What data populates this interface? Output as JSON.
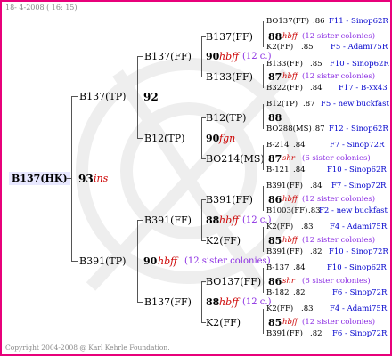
{
  "header": {
    "date": "18- 4-2008 ( 16: 15)"
  },
  "footer": {
    "copyright": "Copyright 2004-2008 @ Karl Kehrle Foundation."
  },
  "colors": {
    "frame": "#e8007a",
    "root_bg": "#e8e8ff",
    "ins": "#cc0000",
    "sister": "#8a2be2",
    "leaf_note": "#0000cc"
  },
  "root": {
    "name": "B137(HK)",
    "number": "93",
    "code": "ins"
  },
  "gen1": [
    {
      "name": "B137(TP)",
      "number": "92"
    },
    {
      "name": "B391(TP)",
      "number": "90",
      "code": "hbff",
      "note": "(12 sister colonies)"
    }
  ],
  "gen2": [
    {
      "name": "B137(FF)",
      "number": "90",
      "code": "hbff",
      "note": "(12 c.)"
    },
    {
      "name": "B12(TP)",
      "number": "90",
      "code": "fgn"
    },
    {
      "name": "B391(FF)",
      "number": "88",
      "code": "hbff",
      "note": "(12 c.)"
    },
    {
      "name": "B137(FF)",
      "number": "88",
      "code": "hbff",
      "note": "(12 c.)"
    }
  ],
  "gen3": [
    {
      "name": "B137(FF)",
      "number": "88",
      "code": "hbff",
      "note": "(12 sister colonies)"
    },
    {
      "name": "B133(FF)",
      "number": "87",
      "code": "hbff",
      "note": "(12 sister colonies)"
    },
    {
      "name": "B12(TP)",
      "number": "88"
    },
    {
      "name": "BO214(MS)",
      "number": "87",
      "code": "shr",
      "note": "(6 sister colonies)"
    },
    {
      "name": "B391(FF)",
      "number": "86",
      "code": "hbff",
      "note": "(12 sister colonies)"
    },
    {
      "name": "K2(FF)",
      "number": "85",
      "code": "hbff",
      "note": "(12 sister colonies)"
    },
    {
      "name": "BO137(FF)",
      "number": "86",
      "code": "shr",
      "note": "(6 sister colonies)"
    },
    {
      "name": "K2(FF)",
      "number": "85",
      "code": "hbff",
      "note": "(12 sister colonies)"
    }
  ],
  "gen4": [
    {
      "name": "BO137(FF)",
      "value": ".86",
      "note": "F11 - Sinop62R"
    },
    {
      "name": "K2(FF)",
      "value": ".85",
      "note": "F5 - Adami75R"
    },
    {
      "name": "B133(FF)",
      "value": ".85",
      "note": "F10 - Sinop62R"
    },
    {
      "name": "B322(FF)",
      "value": ".84",
      "note": "F17 - B-xx43"
    },
    {
      "name": "B12(TP)",
      "value": ".87",
      "note": "F5 - new buckfast"
    },
    {
      "name": "BO288(MS)",
      "value": ".87",
      "note": "F12 - Sinop62R"
    },
    {
      "name": "B-214",
      "value": ".84",
      "note": "F7 - Sinop72R"
    },
    {
      "name": "B-121",
      "value": ".84",
      "note": "F10 - Sinop62R"
    },
    {
      "name": "B391(FF)",
      "value": ".84",
      "note": "F7 - Sinop72R"
    },
    {
      "name": "B1003(FF)",
      "value": ".83",
      "note": "F2 - new buckfast"
    },
    {
      "name": "K2(FF)",
      "value": ".83",
      "note": "F4 - Adami75R"
    },
    {
      "name": "B391(FF)",
      "value": ".82",
      "note": "F10 - Sinop72R"
    },
    {
      "name": "B-137",
      "value": ".84",
      "note": "F10 - Sinop62R"
    },
    {
      "name": "B-182",
      "value": ".82",
      "note": "F6 - Sinop72R"
    },
    {
      "name": "K2(FF)",
      "value": ".83",
      "note": "F4 - Adami75R"
    },
    {
      "name": "B391(FF)",
      "value": ".82",
      "note": "F6 - Sinop72R"
    }
  ]
}
